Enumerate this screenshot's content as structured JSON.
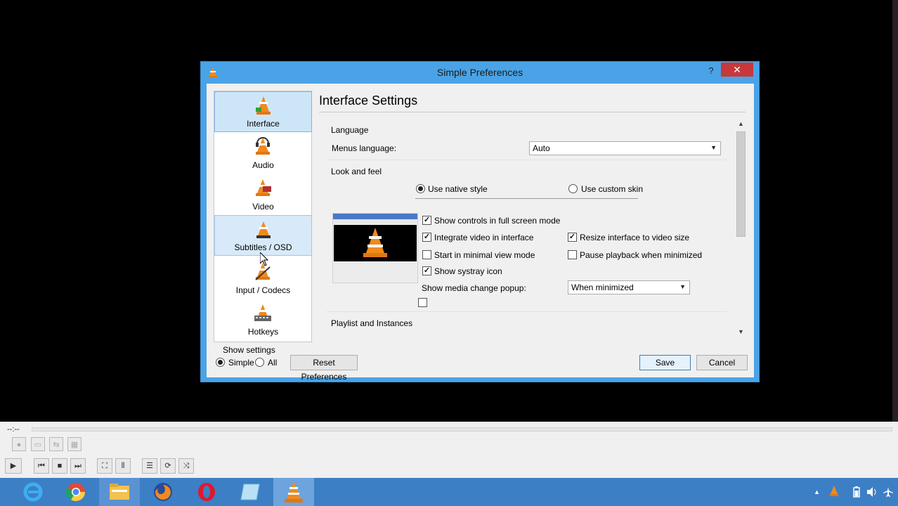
{
  "dialog": {
    "title": "Simple Preferences",
    "help_label": "?",
    "close_label": "✕"
  },
  "sidebar": {
    "items": [
      {
        "label": "Interface",
        "icon": "interface-cone-icon"
      },
      {
        "label": "Audio",
        "icon": "audio-cone-icon"
      },
      {
        "label": "Video",
        "icon": "video-cone-icon"
      },
      {
        "label": "Subtitles / OSD",
        "icon": "subtitles-cone-icon"
      },
      {
        "label": "Input / Codecs",
        "icon": "input-cone-icon"
      },
      {
        "label": "Hotkeys",
        "icon": "hotkeys-cone-icon"
      }
    ],
    "selected": "Interface"
  },
  "main": {
    "title": "Interface Settings",
    "language": {
      "group_label": "Language",
      "menus_language_label": "Menus language:",
      "menus_language_value": "Auto"
    },
    "look_and_feel": {
      "group_label": "Look and feel",
      "native_style_label": "Use native style",
      "native_style_selected": true,
      "custom_skin_label": "Use custom skin",
      "custom_skin_selected": false,
      "options": {
        "fullscreen_controls": {
          "label": "Show controls in full screen mode",
          "checked": true
        },
        "integrate_video": {
          "label": "Integrate video in interface",
          "checked": true
        },
        "resize_interface": {
          "label": "Resize interface to video size",
          "checked": true
        },
        "minimal_view": {
          "label": "Start in minimal view mode",
          "checked": false
        },
        "pause_minimized": {
          "label": "Pause playback when minimized",
          "checked": false
        },
        "systray_icon": {
          "label": "Show systray icon",
          "checked": true
        }
      },
      "media_popup_label": "Show media change popup:",
      "media_popup_value": "When minimized"
    },
    "playlist": {
      "group_label": "Playlist and Instances"
    }
  },
  "footer": {
    "show_settings_label": "Show settings",
    "simple_label": "Simple",
    "all_label": "All",
    "reset_label": "Reset Preferences",
    "save_label": "Save",
    "cancel_label": "Cancel"
  },
  "player": {
    "time": "--:--"
  },
  "colors": {
    "accent": "#4aa3e6",
    "close": "#c7383c",
    "taskbar": "#3d7fc5"
  }
}
